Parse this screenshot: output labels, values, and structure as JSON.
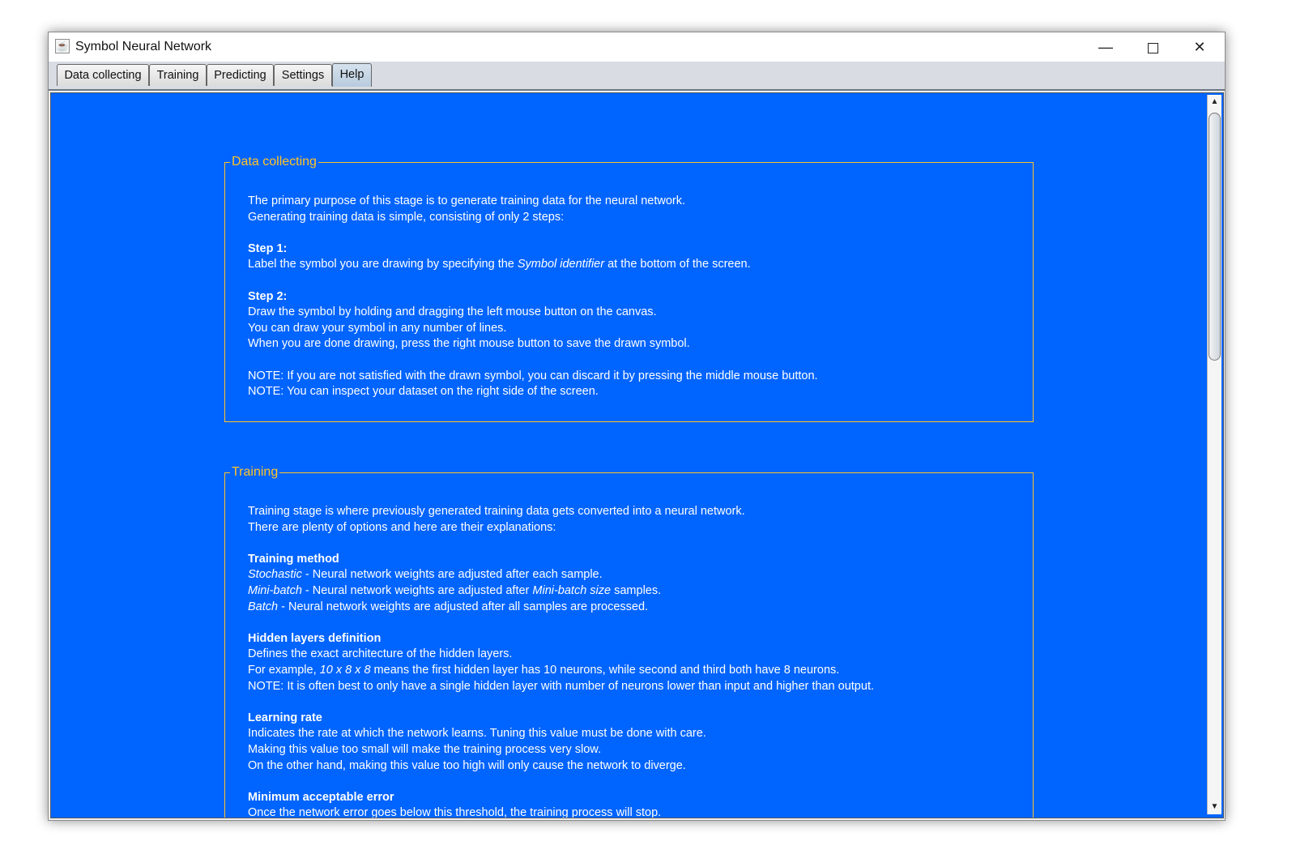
{
  "window": {
    "title": "Symbol Neural Network",
    "app_icon": "java-cup-icon",
    "controls": {
      "minimize": "—",
      "close": "✕"
    }
  },
  "tabs": [
    {
      "label": "Data collecting",
      "selected": false
    },
    {
      "label": "Training",
      "selected": false
    },
    {
      "label": "Predicting",
      "selected": false
    },
    {
      "label": "Settings",
      "selected": false
    },
    {
      "label": "Help",
      "selected": true
    }
  ],
  "colors": {
    "content_bg": "#0064ff",
    "section_border": "#ffc426",
    "text": "#ffffff"
  },
  "help": {
    "data_collecting": {
      "title": "Data collecting",
      "intro1": "The primary purpose of this stage is to generate training data for the neural network.",
      "intro2": "Generating training data is simple, consisting of only 2 steps:",
      "step1_head": "Step 1:",
      "step1_pre": "Label the symbol you are drawing by specifying the ",
      "step1_em": "Symbol identifier",
      "step1_post": " at the bottom of the screen.",
      "step2_head": "Step 2:",
      "step2_l1": "Draw the symbol by holding and dragging the left mouse button on the canvas.",
      "step2_l2": "You can draw your symbol in any number of lines.",
      "step2_l3": "When you are done drawing, press the right mouse button to save the drawn symbol.",
      "note1": "NOTE: If you are not satisfied with the drawn symbol, you can discard it by pressing the middle mouse button.",
      "note2": "NOTE: You can inspect your dataset on the right side of the screen."
    },
    "training": {
      "title": "Training",
      "intro1": "Training stage is where previously generated training data gets converted into a neural network.",
      "intro2": "There are plenty of options and here are their explanations:",
      "method_head": "Training method",
      "stochastic_em": "Stochastic",
      "stochastic_text": " - Neural network weights are adjusted after each sample.",
      "minibatch_em": "Mini-batch",
      "minibatch_text": " - Neural network weights are adjusted after ",
      "minibatch_size_em": "Mini-batch size",
      "minibatch_tail": " samples.",
      "batch_em": "Batch",
      "batch_text": " - Neural network weights are adjusted after all samples are processed.",
      "hidden_head": "Hidden layers definition",
      "hidden_l1": "Defines the exact architecture of the hidden layers.",
      "hidden_l2_pre": "For example, ",
      "hidden_l2_em": "10 x 8 x 8",
      "hidden_l2_post": " means the first hidden layer has 10 neurons, while second and third both have 8 neurons.",
      "hidden_note": "NOTE: It is often best to only have a single hidden layer with number of neurons lower than input and higher than output.",
      "lr_head": "Learning rate",
      "lr_l1": "Indicates the rate at which the network learns. Tuning this value must be done with care.",
      "lr_l2": "Making this value too small will make the training process very slow.",
      "lr_l3": "On the other hand, making this value too high will only cause the network to diverge.",
      "mae_head": "Minimum acceptable error",
      "mae_l1": "Once the network error goes below this threshold, the training process will stop."
    }
  },
  "scrollbar": {
    "up": "▲",
    "down": "▼"
  }
}
